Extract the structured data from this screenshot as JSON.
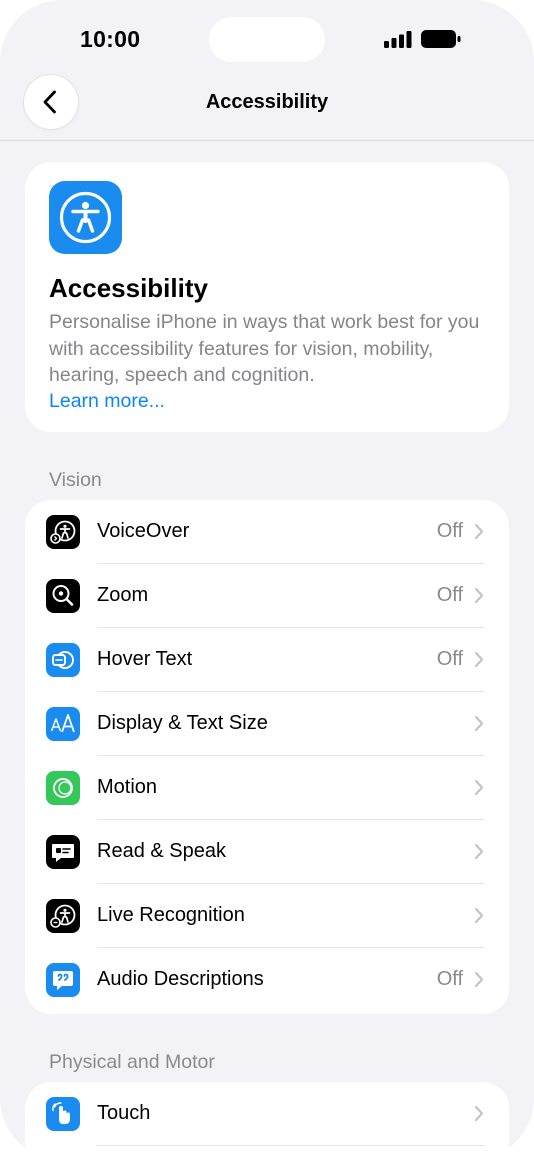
{
  "status_bar": {
    "time": "10:00"
  },
  "nav": {
    "title": "Accessibility"
  },
  "hero": {
    "title": "Accessibility",
    "description": "Personalise iPhone in ways that work best for you with accessibility features for vision, mobility, hearing, speech and cognition.",
    "link": "Learn more..."
  },
  "sections": {
    "vision": {
      "title": "Vision",
      "rows": [
        {
          "label": "VoiceOver",
          "value": "Off",
          "icon": "voiceover-icon",
          "color": "#000000"
        },
        {
          "label": "Zoom",
          "value": "Off",
          "icon": "zoom-icon",
          "color": "#000000"
        },
        {
          "label": "Hover Text",
          "value": "Off",
          "icon": "hover-text-icon",
          "color": "#1a8cf0"
        },
        {
          "label": "Display & Text Size",
          "value": "",
          "icon": "display-text-size-icon",
          "color": "#1a8cf0"
        },
        {
          "label": "Motion",
          "value": "",
          "icon": "motion-icon",
          "color": "#34c759"
        },
        {
          "label": "Read & Speak",
          "value": "",
          "icon": "read-speak-icon",
          "color": "#000000"
        },
        {
          "label": "Live Recognition",
          "value": "",
          "icon": "live-recognition-icon",
          "color": "#000000"
        },
        {
          "label": "Audio Descriptions",
          "value": "Off",
          "icon": "audio-descriptions-icon",
          "color": "#1a8cf0"
        }
      ]
    },
    "physical": {
      "title": "Physical and Motor",
      "rows": [
        {
          "label": "Touch",
          "value": "",
          "icon": "touch-icon",
          "color": "#1a8cf0"
        }
      ]
    }
  }
}
